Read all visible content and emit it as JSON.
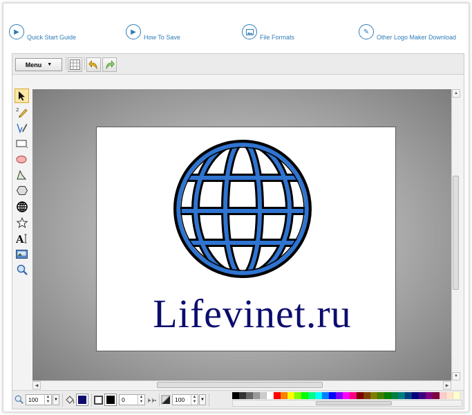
{
  "help_links": [
    {
      "label": "Quick Start Guide",
      "icon": "play-icon"
    },
    {
      "label": "How To Save",
      "icon": "play-icon"
    },
    {
      "label": "File Formats",
      "icon": "image-icon"
    },
    {
      "label": "Other Logo Maker Download",
      "icon": "pencil-icon"
    }
  ],
  "toolbar": {
    "menu_label": "Menu",
    "buttons": [
      "grid-icon",
      "undo-icon",
      "redo-icon"
    ]
  },
  "tools": [
    "pointer-icon",
    "pencil-tool-icon",
    "pen-tool-icon",
    "rectangle-icon",
    "ellipse-icon",
    "path-icon",
    "polygon-icon",
    "globe-shape-icon",
    "star-icon",
    "text-icon",
    "image-icon",
    "zoom-icon"
  ],
  "canvas": {
    "logo_text": "Lifevinet.ru",
    "text_color": "#0c0c6e",
    "globe_fill": "#2f74d0",
    "globe_stroke": "#000000"
  },
  "bottombar": {
    "zoom_value": "100",
    "stroke_width_value": "0",
    "opacity_value": "100",
    "fill_color": "#0c0c6e",
    "stroke_color": "#000000"
  },
  "palette_row1": [
    "#000000",
    "#333333",
    "#666666",
    "#999999",
    "#cccccc",
    "#ffffff",
    "#ff0000",
    "#ff7f00",
    "#ffff00",
    "#7fff00",
    "#00ff00",
    "#00ff7f",
    "#00ffff",
    "#007fff",
    "#0000ff",
    "#7f00ff",
    "#ff00ff",
    "#ff007f",
    "#7f0000",
    "#7f3f00",
    "#7f7f00",
    "#3f7f00",
    "#007f00",
    "#007f3f",
    "#007f7f",
    "#003f7f",
    "#00007f",
    "#3f007f",
    "#7f007f",
    "#7f003f",
    "#ffcccc",
    "#ffe5cc",
    "#ffffcc"
  ],
  "palette_row2": [
    "#1a1a1a",
    "#4d4d4d",
    "#808080",
    "#b3b3b3",
    "#e6e6e6",
    "#f5f5f5",
    "#ff4d4d",
    "#ffa64d",
    "#ffff4d",
    "#a6ff4d",
    "#4dff4d",
    "#4dffa6",
    "#4dffff",
    "#4da6ff",
    "#4d4dff",
    "#a64dff",
    "#ff4dff",
    "#ff4da6",
    "#993333",
    "#996633",
    "#999933",
    "#669933",
    "#339933",
    "#339966",
    "#339999",
    "#336699",
    "#333399",
    "#663399",
    "#993399",
    "#993366",
    "#ffe0e0",
    "#fff0e0",
    "#ffffe0"
  ]
}
